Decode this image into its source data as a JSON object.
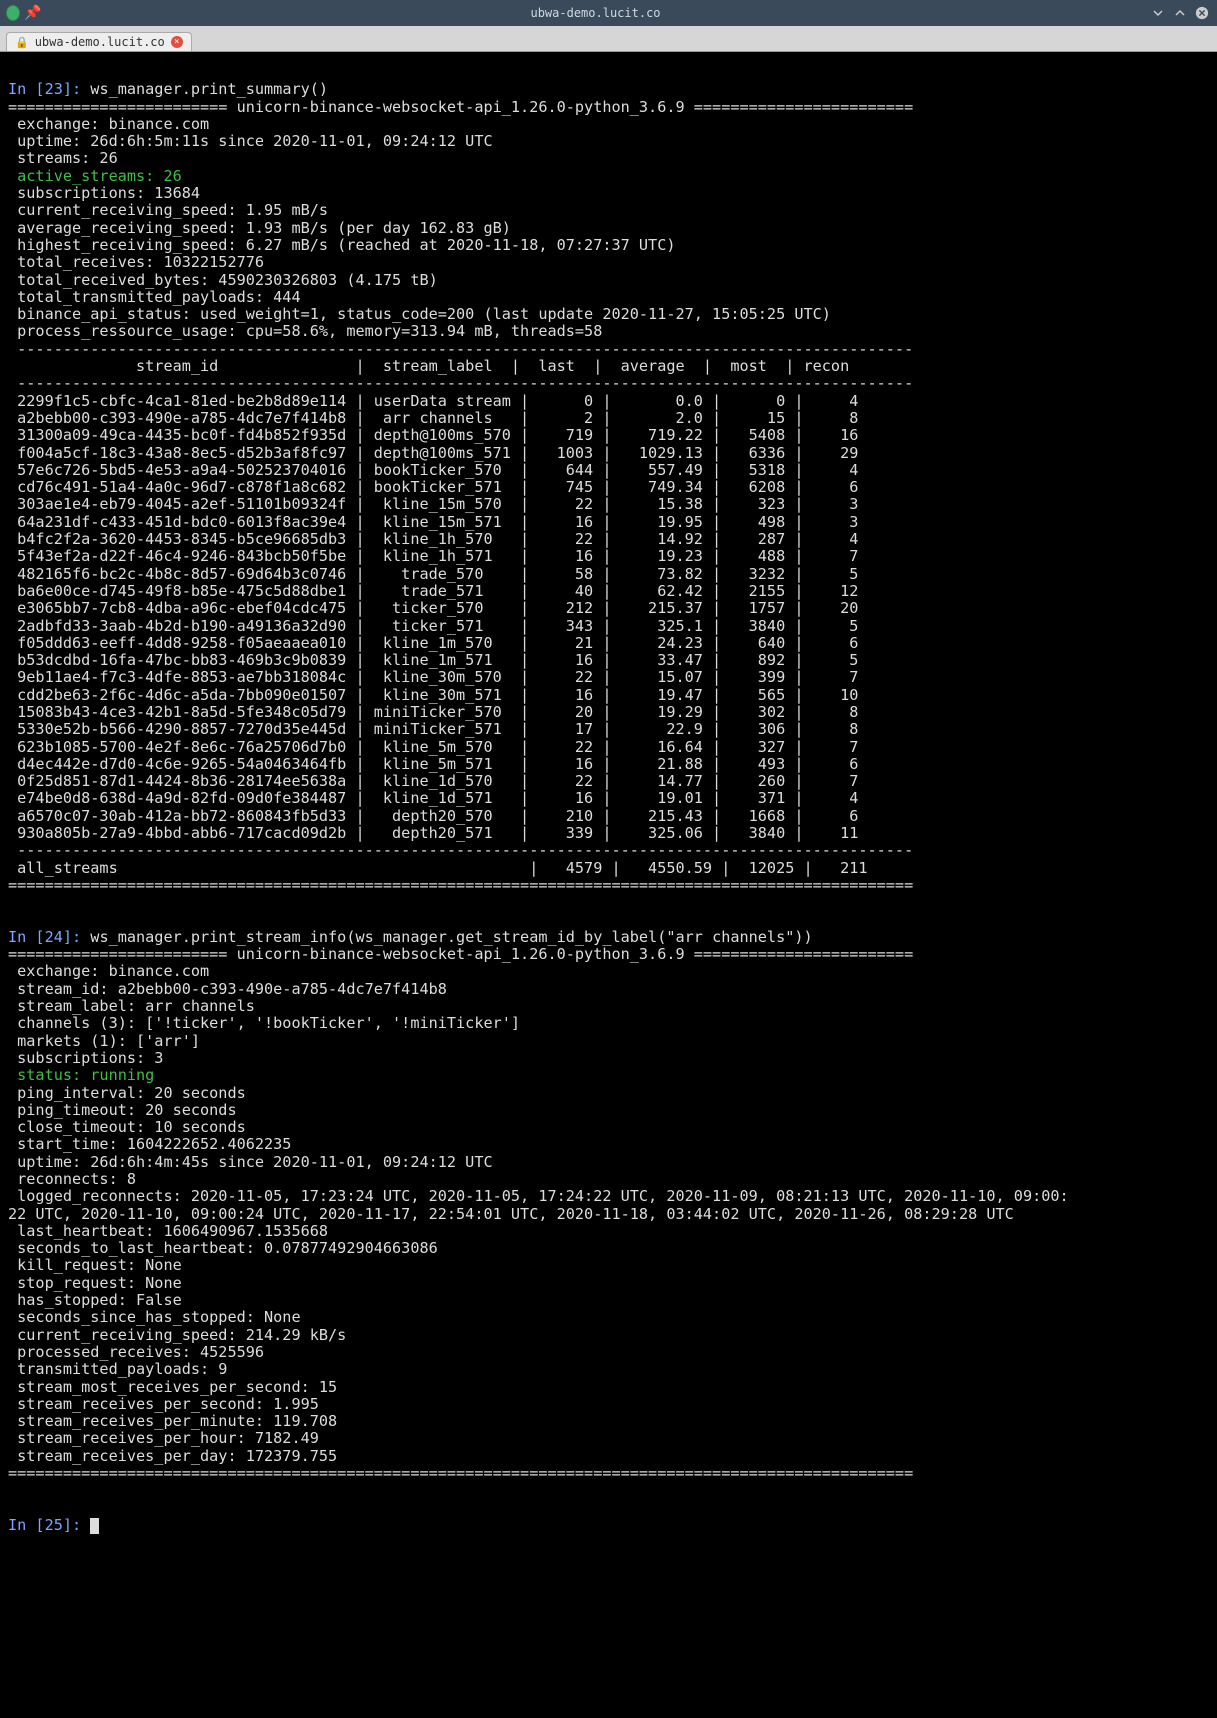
{
  "window": {
    "title": "ubwa-demo.lucit.co",
    "tab_label": "ubwa-demo.lucit.co"
  },
  "sections": {
    "s1_prompt": {
      "num": "In [23]:",
      "cmd": " ws_manager.print_summary()"
    },
    "s1_banner": "======================== unicorn-binance-websocket-api_1.26.0-python_3.6.9 ========================",
    "s1_lines": [
      " exchange: binance.com",
      " uptime: 26d:6h:5m:11s since 2020-11-01, 09:24:12 UTC",
      " streams: 26"
    ],
    "s1_active": " active_streams: 26",
    "s1_lines2": [
      " subscriptions: 13684",
      " current_receiving_speed: 1.95 mB/s",
      " average_receiving_speed: 1.93 mB/s (per day 162.83 gB)",
      " highest_receiving_speed: 6.27 mB/s (reached at 2020-11-18, 07:27:37 UTC)",
      " total_receives: 10322152776",
      " total_received_bytes: 4590230326803 (4.175 tB)",
      " total_transmitted_payloads: 444",
      " binance_api_status: used_weight=1, status_code=200 (last update 2020-11-27, 15:05:25 UTC)",
      " process_ressource_usage: cpu=58.6%, memory=313.94 mB, threads=58"
    ],
    "rule_dash": " --------------------------------------------------------------------------------------------------",
    "tbl_header": "              stream_id               |  stream_label  |  last  |  average  |  most  | recon ",
    "tbl_rows": [
      " 2299f1c5-cbfc-4ca1-81ed-be2b8d89e114 | userData stream |      0 |       0.0 |      0 |     4 ",
      " a2bebb00-c393-490e-a785-4dc7e7f414b8 |  arr channels   |      2 |       2.0 |     15 |     8 ",
      " 31300a09-49ca-4435-bc0f-fd4b852f935d | depth@100ms_570 |    719 |    719.22 |   5408 |    16 ",
      " f004a5cf-18c3-43a8-8ec5-d52b3af8fc97 | depth@100ms_571 |   1003 |   1029.13 |   6336 |    29 ",
      " 57e6c726-5bd5-4e53-a9a4-502523704016 | bookTicker_570  |    644 |    557.49 |   5318 |     4 ",
      " cd76c491-51a4-4a0c-96d7-c878f1a8c682 | bookTicker_571  |    745 |    749.34 |   6208 |     6 ",
      " 303ae1e4-eb79-4045-a2ef-51101b09324f |  kline_15m_570  |     22 |     15.38 |    323 |     3 ",
      " 64a231df-c433-451d-bdc0-6013f8ac39e4 |  kline_15m_571  |     16 |     19.95 |    498 |     3 ",
      " b4fc2f2a-3620-4453-8345-b5ce96685db3 |  kline_1h_570   |     22 |     14.92 |    287 |     4 ",
      " 5f43ef2a-d22f-46c4-9246-843bcb50f5be |  kline_1h_571   |     16 |     19.23 |    488 |     7 ",
      " 482165f6-bc2c-4b8c-8d57-69d64b3c0746 |    trade_570    |     58 |     73.82 |   3232 |     5 ",
      " ba6e00ce-d745-49f8-b85e-475c5d88dbe1 |    trade_571    |     40 |     62.42 |   2155 |    12 ",
      " e3065bb7-7cb8-4dba-a96c-ebef04cdc475 |   ticker_570    |    212 |    215.37 |   1757 |    20 ",
      " 2adbfd33-3aab-4b2d-b190-a49136a32d90 |   ticker_571    |    343 |     325.1 |   3840 |     5 ",
      " f05ddd63-eeff-4dd8-9258-f05aeaaea010 |  kline_1m_570   |     21 |     24.23 |    640 |     6 ",
      " b53dcdbd-16fa-47bc-bb83-469b3c9b0839 |  kline_1m_571   |     16 |     33.47 |    892 |     5 ",
      " 9eb11ae4-f7c3-4dfe-8853-ae7bb318084c |  kline_30m_570  |     22 |     15.07 |    399 |     7 ",
      " cdd2be63-2f6c-4d6c-a5da-7bb090e01507 |  kline_30m_571  |     16 |     19.47 |    565 |    10 ",
      " 15083b43-4ce3-42b1-8a5d-5fe348c05d79 | miniTicker_570  |     20 |     19.29 |    302 |     8 ",
      " 5330e52b-b566-4290-8857-7270d35e445d | miniTicker_571  |     17 |      22.9 |    306 |     8 ",
      " 623b1085-5700-4e2f-8e6c-76a25706d7b0 |  kline_5m_570   |     22 |     16.64 |    327 |     7 ",
      " d4ec442e-d7d0-4c6e-9265-54a0463464fb |  kline_5m_571   |     16 |     21.88 |    493 |     6 ",
      " 0f25d851-87d1-4424-8b36-28174ee5638a |  kline_1d_570   |     22 |     14.77 |    260 |     7 ",
      " e74be0d8-638d-4a9d-82fd-09d0fe384487 |  kline_1d_571   |     16 |     19.01 |    371 |     4 ",
      " a6570c07-30ab-412a-bb72-860843fb5d33 |   depth20_570   |    210 |    215.43 |   1668 |     6 ",
      " 930a805b-27a9-4bbd-abb6-717cacd09d2b |   depth20_571   |    339 |    325.06 |   3840 |    11 "
    ],
    "tbl_total": " all_streams                                             |   4579 |   4550.59 |  12025 |   211 ",
    "rule_eq": "===================================================================================================",
    "s2_prompt": {
      "num": "In [24]:",
      "cmd": " ws_manager.print_stream_info(ws_manager.get_stream_id_by_label(\"arr channels\"))"
    },
    "s2_lines1": [
      " exchange: binance.com",
      " stream_id: a2bebb00-c393-490e-a785-4dc7e7f414b8",
      " stream_label: arr channels",
      " channels (3): ['!ticker', '!bookTicker', '!miniTicker']",
      " markets (1): ['arr']",
      " subscriptions: 3"
    ],
    "s2_status": " status: running",
    "s2_lines2": [
      " ping_interval: 20 seconds",
      " ping_timeout: 20 seconds",
      " close_timeout: 10 seconds",
      " start_time: 1604222652.4062235",
      " uptime: 26d:6h:4m:45s since 2020-11-01, 09:24:12 UTC",
      " reconnects: 8",
      " logged_reconnects: 2020-11-05, 17:23:24 UTC, 2020-11-05, 17:24:22 UTC, 2020-11-09, 08:21:13 UTC, 2020-11-10, 09:00:",
      "22 UTC, 2020-11-10, 09:00:24 UTC, 2020-11-17, 22:54:01 UTC, 2020-11-18, 03:44:02 UTC, 2020-11-26, 08:29:28 UTC",
      " last_heartbeat: 1606490967.1535668",
      " seconds_to_last_heartbeat: 0.07877492904663086",
      " kill_request: None",
      " stop_request: None",
      " has_stopped: False",
      " seconds_since_has_stopped: None",
      " current_receiving_speed: 214.29 kB/s",
      " processed_receives: 4525596",
      " transmitted_payloads: 9",
      " stream_most_receives_per_second: 15",
      " stream_receives_per_second: 1.995",
      " stream_receives_per_minute: 119.708",
      " stream_receives_per_hour: 7182.49",
      " stream_receives_per_day: 172379.755"
    ],
    "s3_prompt": {
      "num": "In [25]:",
      "cmd": " "
    }
  }
}
